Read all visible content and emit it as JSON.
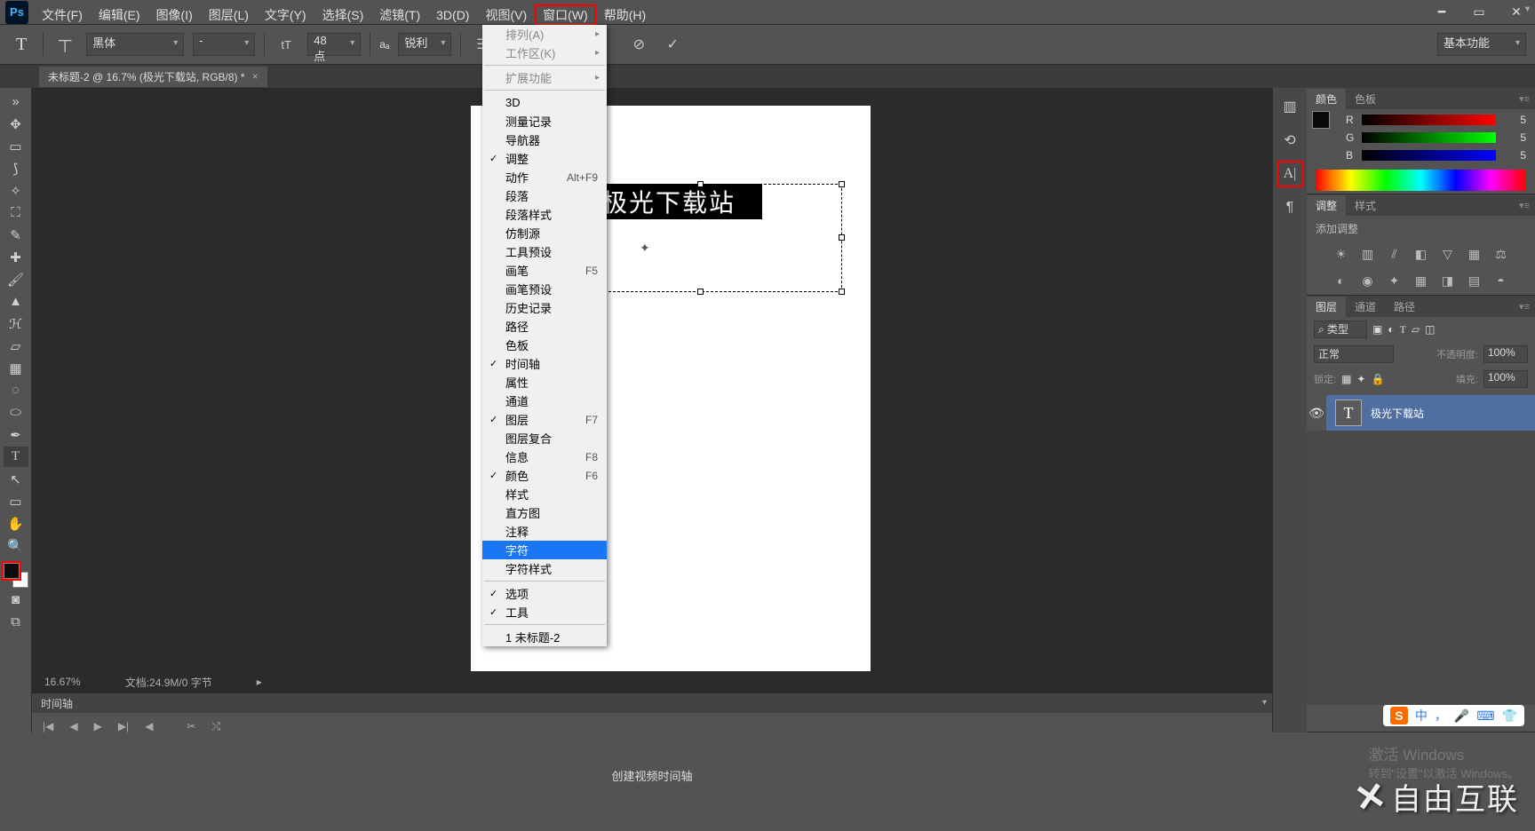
{
  "app": {
    "logo": "Ps"
  },
  "menu": {
    "file": "文件(F)",
    "edit": "编辑(E)",
    "image": "图像(I)",
    "layer": "图层(L)",
    "type": "文字(Y)",
    "select": "选择(S)",
    "filter": "滤镜(T)",
    "threeD": "3D(D)",
    "view": "视图(V)",
    "window": "窗口(W)",
    "help": "帮助(H)"
  },
  "options": {
    "font": "黑体",
    "size": "48 点",
    "aa": "锐利",
    "workspace_btn": "基本功能"
  },
  "docTab": {
    "title": "未标题-2 @ 16.7% (极光下载站, RGB/8) *"
  },
  "canvas": {
    "text": "极光下载站"
  },
  "status": {
    "zoom": "16.67%",
    "doc": "文档:24.9M/0 字节"
  },
  "timeline": {
    "title": "时间轴",
    "create": "创建视频时间轴"
  },
  "dropdown": {
    "arrange": "排列(A)",
    "workspace": "工作区(K)",
    "extensions": "扩展功能",
    "threeD": "3D",
    "measure": "测量记录",
    "navigator": "导航器",
    "adjustments": "调整",
    "actions": "动作",
    "actions_sc": "Alt+F9",
    "paragraph": "段落",
    "paraStyle": "段落样式",
    "clone": "仿制源",
    "toolPreset": "工具预设",
    "brush": "画笔",
    "brush_sc": "F5",
    "brushPreset": "画笔预设",
    "history": "历史记录",
    "paths": "路径",
    "swatches": "色板",
    "timeline": "时间轴",
    "properties": "属性",
    "channels": "通道",
    "layers": "图层",
    "layers_sc": "F7",
    "layerComps": "图层复合",
    "info": "信息",
    "info_sc": "F8",
    "color": "颜色",
    "color_sc": "F6",
    "styles": "样式",
    "histogram": "直方图",
    "notes": "注释",
    "character": "字符",
    "charStyles": "字符样式",
    "options": "选项",
    "tools": "工具",
    "doc1": "1 未标题-2"
  },
  "colorPanel": {
    "tab1": "颜色",
    "tab2": "色板",
    "r_label": "R",
    "g_label": "G",
    "b_label": "B",
    "r_val": "5",
    "g_val": "5",
    "b_val": "5"
  },
  "adjPanel": {
    "tab1": "调整",
    "tab2": "样式",
    "addLabel": "添加调整"
  },
  "layerPanel": {
    "tab1": "图层",
    "tab2": "通道",
    "tab3": "路径",
    "kind": "⌕ 类型",
    "blend": "正常",
    "opacityLabel": "不透明度:",
    "opacity": "100%",
    "lockLabel": "锁定:",
    "fillLabel": "填充:",
    "fill": "100%",
    "layerName": "极光下载站"
  },
  "watermark": {
    "text": "自由互联"
  },
  "activate": {
    "l1": "激活 Windows",
    "l2": "转到\"设置\"以激活 Windows。"
  },
  "sogou": {
    "zh": "中",
    "punct": "，"
  }
}
